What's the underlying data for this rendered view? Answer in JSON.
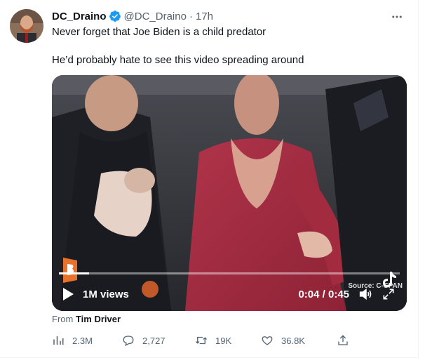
{
  "tweet": {
    "display_name": "DC_Draino",
    "handle": "@DC_Draino",
    "separator": "·",
    "time": "17h",
    "lines": [
      "Never forget that Joe Biden is a child predator",
      "He’d probably hate to see this video spreading around"
    ]
  },
  "video": {
    "views": "1M views",
    "time_display": "0:04 / 0:45",
    "progress_fraction": 0.089,
    "source_overlay": "Source: C-SPAN"
  },
  "attribution": {
    "prefix": "From",
    "name": "Tim Driver"
  },
  "actions": {
    "views": "2.3M",
    "replies": "2,727",
    "retweets": "19K",
    "likes": "36.8K"
  },
  "colors": {
    "verified": "#1d9bf0",
    "muted": "#536471",
    "text": "#0f1419"
  }
}
